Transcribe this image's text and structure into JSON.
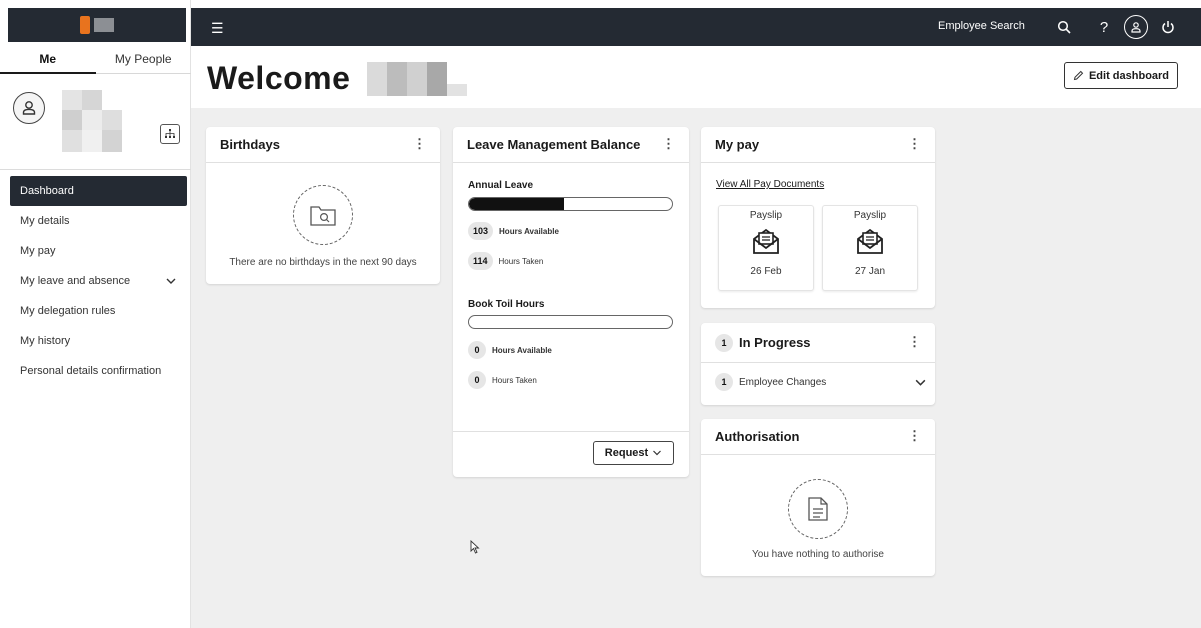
{
  "sidebar": {
    "tabs": [
      "Me",
      "My People"
    ],
    "nav": [
      "Dashboard",
      "My details",
      "My pay",
      "My leave and absence",
      "My delegation rules",
      "My history",
      "Personal details confirmation"
    ]
  },
  "topbar": {
    "employee_search": "Employee Search",
    "help_label": "?"
  },
  "header": {
    "welcome": "Welcome",
    "edit_button": "Edit dashboard"
  },
  "birthdays": {
    "title": "Birthdays",
    "empty_text": "There are no birthdays in the next 90 days"
  },
  "leave": {
    "title": "Leave Management Balance",
    "annual": {
      "label": "Annual Leave",
      "available": "103",
      "available_label": "Hours Available",
      "taken": "114",
      "taken_label": "Hours Taken",
      "fill_fraction": 0.47
    },
    "toil": {
      "label": "Book Toil Hours",
      "available": "0",
      "available_label": "Hours Available",
      "taken": "0",
      "taken_label": "Hours Taken",
      "fill_fraction": 0
    },
    "request_button": "Request"
  },
  "mypay": {
    "title": "My pay",
    "link": "View All Pay Documents",
    "payslips": [
      {
        "label": "Payslip",
        "date": "26 Feb"
      },
      {
        "label": "Payslip",
        "date": "27 Jan"
      }
    ]
  },
  "in_progress": {
    "count": "1",
    "title": "In Progress",
    "item_count": "1",
    "item_label": "Employee Changes"
  },
  "authorisation": {
    "title": "Authorisation",
    "empty_text": "You have nothing to authorise"
  },
  "colors": {
    "dark": "#242a33",
    "accent": "#e8731e",
    "background": "#efefef"
  }
}
